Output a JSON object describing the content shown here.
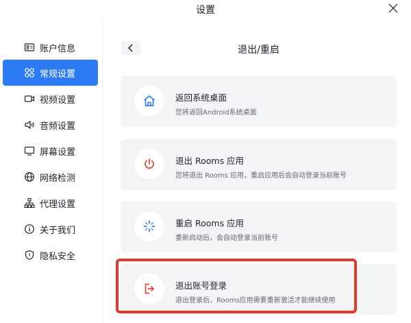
{
  "window": {
    "title": "设置"
  },
  "sidebar": {
    "items": [
      {
        "label": "账户信息",
        "icon": "id-card-icon",
        "active": false
      },
      {
        "label": "常规设置",
        "icon": "grid-icon",
        "active": true
      },
      {
        "label": "视频设置",
        "icon": "video-camera-icon",
        "active": false
      },
      {
        "label": "音频设置",
        "icon": "speaker-icon",
        "active": false
      },
      {
        "label": "屏幕设置",
        "icon": "monitor-icon",
        "active": false
      },
      {
        "label": "网络检测",
        "icon": "globe-icon",
        "active": false
      },
      {
        "label": "代理设置",
        "icon": "network-tree-icon",
        "active": false
      },
      {
        "label": "关于我们",
        "icon": "info-icon",
        "active": false
      },
      {
        "label": "隐私安全",
        "icon": "shield-icon",
        "active": false
      }
    ]
  },
  "main": {
    "title": "退出/重启",
    "cards": [
      {
        "title": "返回系统桌面",
        "desc": "您将返回Android系统桌面",
        "icon": "home-icon"
      },
      {
        "title": "退出 Rooms 应用",
        "desc": "您将退出 Rooms 应用，重启应用后会自动登录当前账号",
        "icon": "power-icon"
      },
      {
        "title": "重启 Rooms 应用",
        "desc": "重新启动后，会自动登录当前账号",
        "icon": "loading-spinner-icon"
      },
      {
        "title": "退出账号登录",
        "desc": "退出登录后，Rooms应用需要重新激活才能继续使用",
        "icon": "logout-icon"
      }
    ]
  },
  "colors": {
    "accent": "#2d7bf4",
    "highlight_border": "#e23a2e",
    "card_bg": "#f3f4f6",
    "power_red": "#e8432f",
    "logout_red": "#e8432f"
  }
}
